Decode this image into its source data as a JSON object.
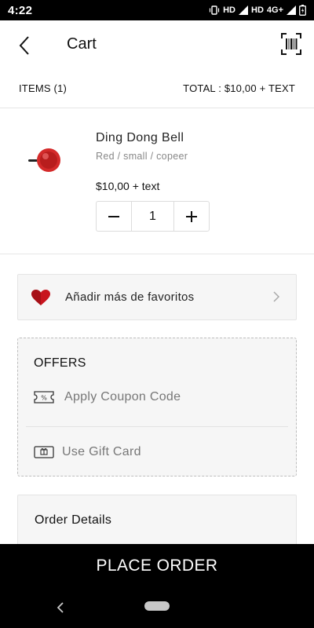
{
  "status_bar": {
    "time": "4:22",
    "indicators": "HD",
    "indicators2": "HD",
    "network": "4G+"
  },
  "header": {
    "title": "Cart",
    "back_icon": "chevron-left-icon",
    "scan_icon": "barcode-scan-icon"
  },
  "summary": {
    "items_label": "ITEMS (1)",
    "total_label": "TOTAL : $10,00  + TEXT"
  },
  "cart_items": [
    {
      "name": "Ding Dong Bell",
      "variant": "Red / small / copeer",
      "price": "$10,00  + text",
      "quantity": "1",
      "minus_label": "−",
      "plus_label": "+"
    }
  ],
  "favorites": {
    "label": "Añadir más de favoritos",
    "icon": "heart-icon"
  },
  "offers": {
    "title": "OFFERS",
    "coupon_label": "Apply Coupon Code",
    "gift_label": "Use Gift Card"
  },
  "order_details": {
    "title": "Order Details"
  },
  "place_order": {
    "label": "PLACE ORDER"
  },
  "colors": {
    "accent": "#000000",
    "heart": "#c8141e",
    "product_red": "#d42a2a"
  }
}
